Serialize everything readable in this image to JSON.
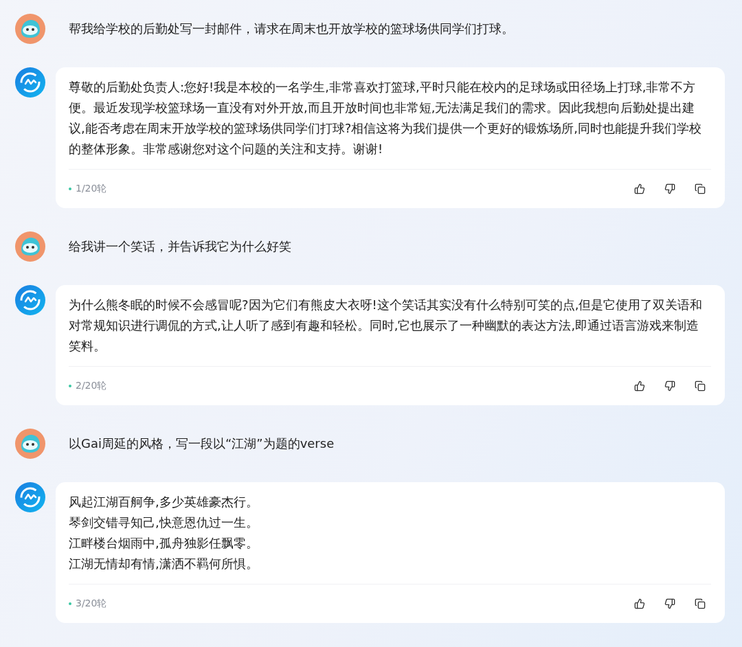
{
  "messages": [
    {
      "kind": "user",
      "text": "帮我给学校的后勤处写一封邮件，请求在周末也开放学校的篮球场供同学们打球。"
    },
    {
      "kind": "reply",
      "lines": [
        "尊敬的后勤处负责人:您好!我是本校的一名学生,非常喜欢打篮球,平时只能在校内的足球场或田径场上打球,非常不方便。最近发现学校篮球场一直没有对外开放,而且开放时间也非常短,无法满足我们的需求。因此我想向后勤处提出建议,能否考虑在周末开放学校的篮球场供同学们打球?相信这将为我们提供一个更好的锻炼场所,同时也能提升我们学校的整体形象。非常感谢您对这个问题的关注和支持。谢谢!"
      ],
      "round": "1/20轮"
    },
    {
      "kind": "user",
      "text": "给我讲一个笑话，并告诉我它为什么好笑"
    },
    {
      "kind": "reply",
      "lines": [
        "为什么熊冬眠的时候不会感冒呢?因为它们有熊皮大衣呀!这个笑话其实没有什么特别可笑的点,但是它使用了双关语和对常规知识进行调侃的方式,让人听了感到有趣和轻松。同时,它也展示了一种幽默的表达方法,即通过语言游戏来制造笑料。"
      ],
      "round": "2/20轮"
    },
    {
      "kind": "user",
      "text": "以Gai周延的风格，写一段以“江湖”为题的verse"
    },
    {
      "kind": "reply",
      "lines": [
        "风起江湖百舸争,多少英雄豪杰行。",
        "琴剑交错寻知己,快意恩仇过一生。",
        "江畔楼台烟雨中,孤舟独影任飘零。",
        "江湖无情却有情,潇洒不羁何所惧。"
      ],
      "round": "3/20轮"
    }
  ]
}
